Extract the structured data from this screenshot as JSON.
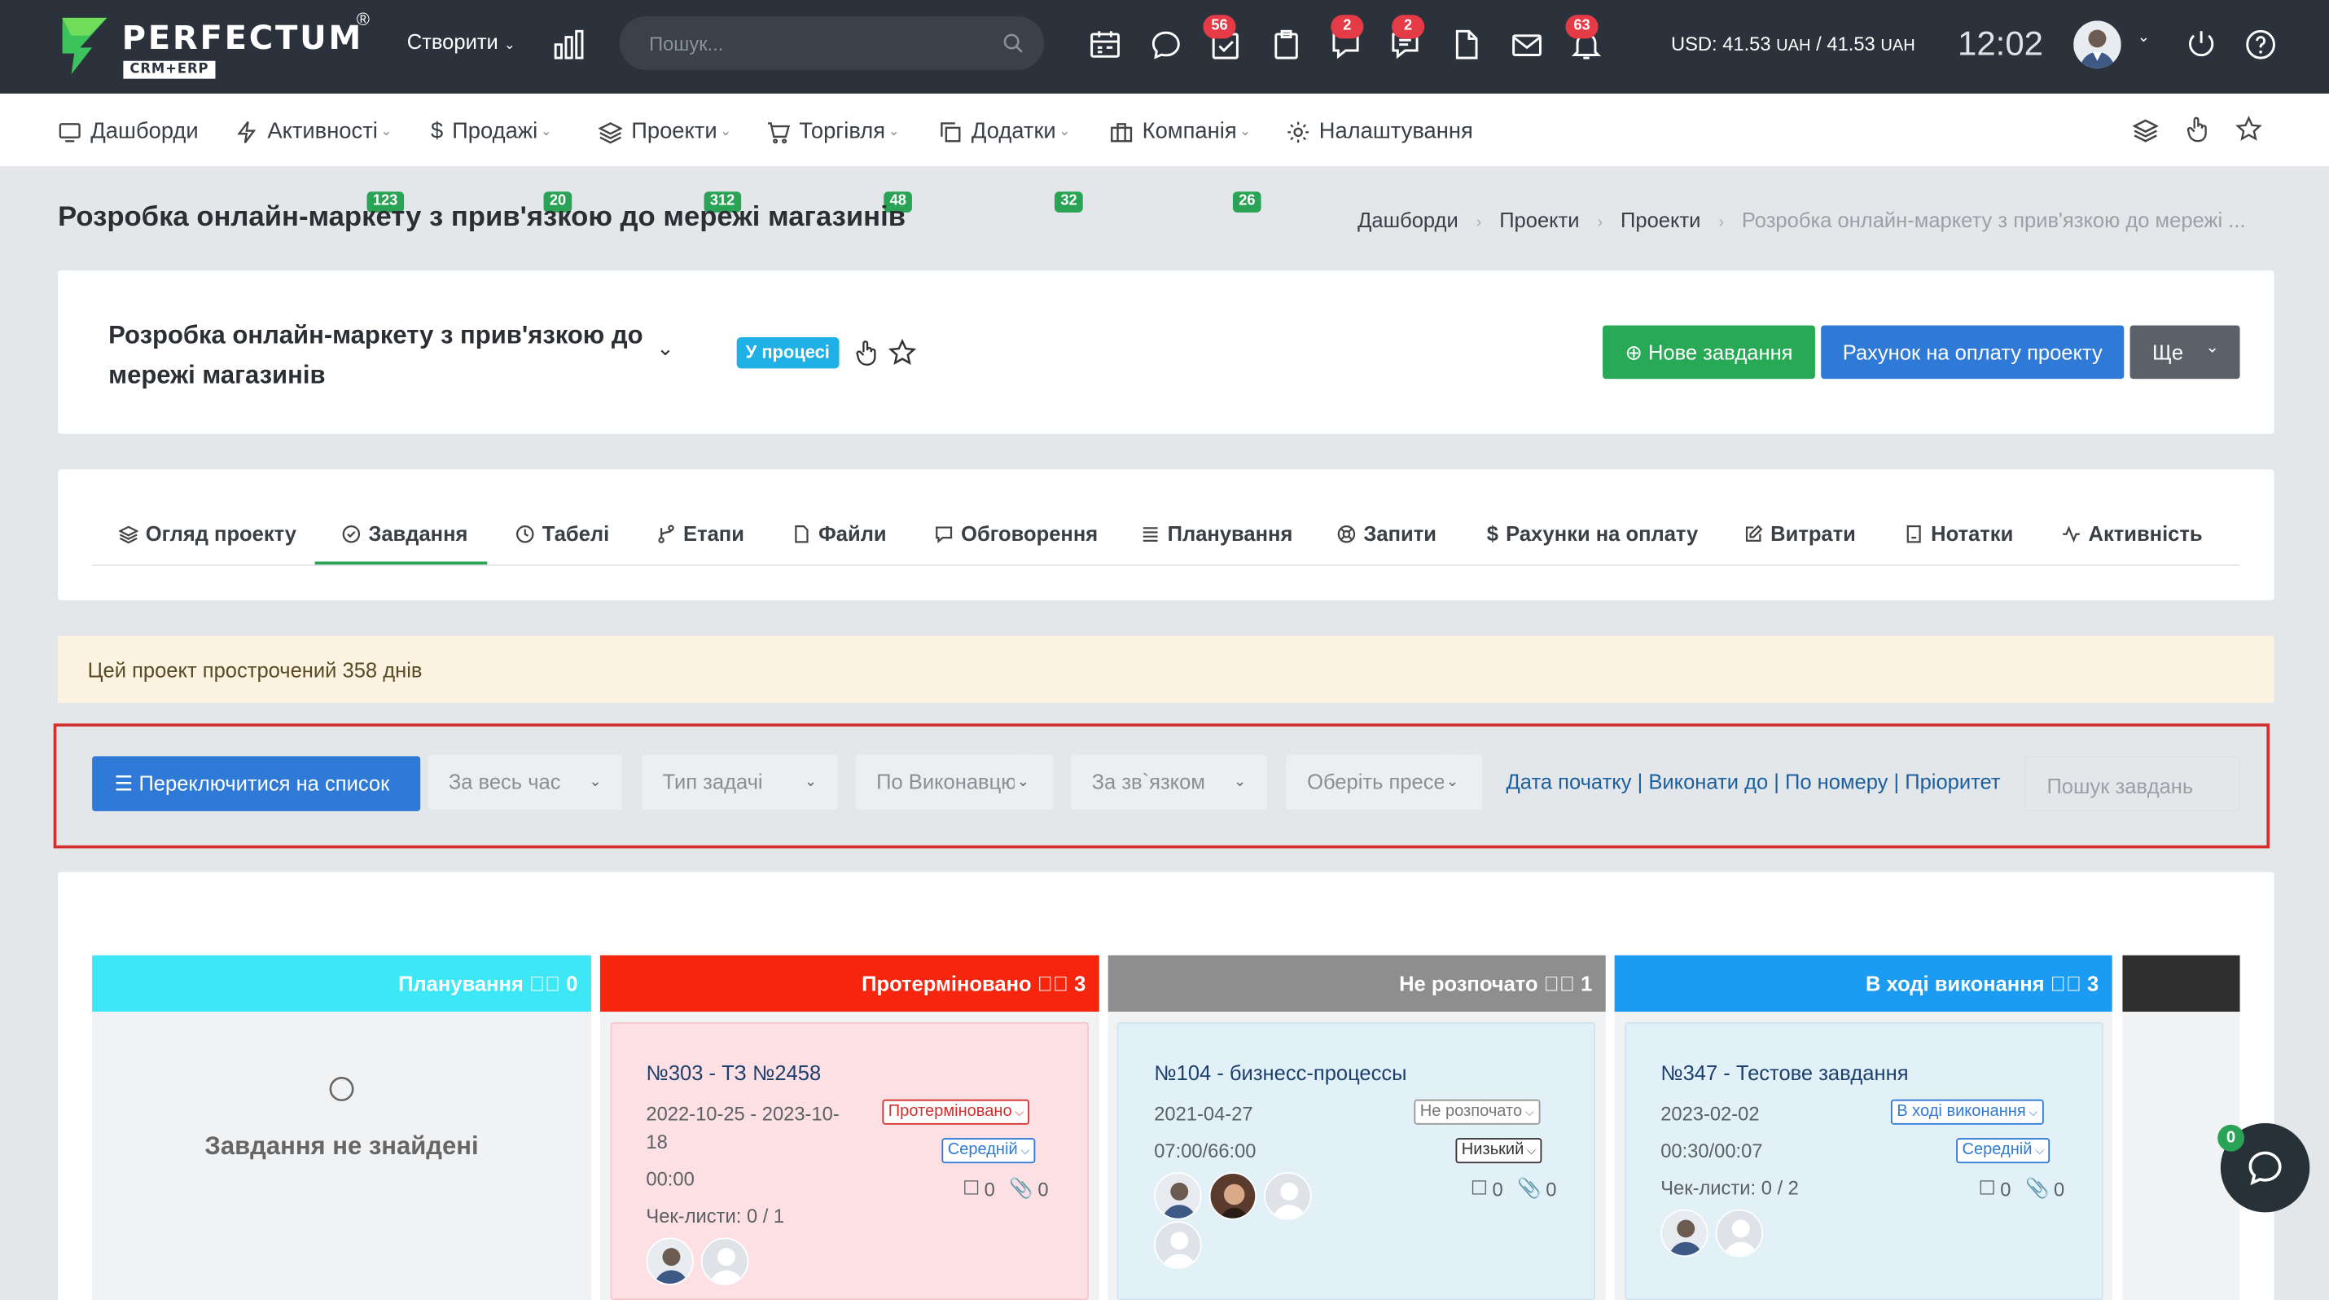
{
  "topbar": {
    "logo_text": "PERFECTUM",
    "logo_sub": "CRM+ERP",
    "logo_reg": "®",
    "create_label": "Створити",
    "search_placeholder": "Пошук...",
    "badges": {
      "tasks": "56",
      "feedback": "2",
      "chat": "2",
      "notifications": "63"
    },
    "rate": "USD: 41.53",
    "rate_unit": "UAH",
    "rate_sep": "/",
    "rate2": "41.53",
    "clock": "12:02"
  },
  "nav": [
    {
      "label": "Дашборди",
      "badge": ""
    },
    {
      "label": "Активності",
      "badge": "123"
    },
    {
      "label": "Продажі",
      "badge": "20"
    },
    {
      "label": "Проекти",
      "badge": "312"
    },
    {
      "label": "Торгівля",
      "badge": "48"
    },
    {
      "label": "Додатки",
      "badge": "32"
    },
    {
      "label": "Компанія",
      "badge": "26"
    },
    {
      "label": "Налаштування",
      "badge": ""
    }
  ],
  "page": {
    "title": "Розробка онлайн-маркету з прив'язкою до мережі магазинів",
    "breadcrumbs": [
      "Дашборди",
      "Проекти",
      "Проекти",
      "Розробка онлайн-маркету з прив'язкою до мережі ..."
    ]
  },
  "project": {
    "title": "Розробка онлайн-маркету з прив'язкою до мережі магазинів",
    "status": "У процесі",
    "btn_new_task": "Нове завдання",
    "btn_invoice": "Рахунок на оплату проекту",
    "btn_more": "Ще"
  },
  "tabs": [
    "Огляд проекту",
    "Завдання",
    "Табелі",
    "Етапи",
    "Файли",
    "Обговорення",
    "Планування",
    "Запити",
    "Рахунки на оплату",
    "Витрати",
    "Нотатки",
    "Активність"
  ],
  "alert": "Цей проект прострочений 358 днів",
  "filters": {
    "switch_list": "Переключитися на список",
    "period": "За весь час",
    "task_type": "Тип задачі",
    "assignee": "По Виконавцю",
    "relation": "За зв`язком",
    "preset": "Оберіть пресет",
    "sort_start": "Дата початку",
    "sort_due": "Виконати до",
    "sort_number": "По номеру",
    "sort_priority": "Пріоритет",
    "sort_sep": "|",
    "search_placeholder": "Пошук завдань"
  },
  "columns": [
    {
      "name": "Планування",
      "count": "0",
      "color": "#3ee7f5"
    },
    {
      "name": "Протерміновано",
      "count": "3",
      "color": "#f5250e"
    },
    {
      "name": "Не розпочато",
      "count": "1",
      "color": "#8e8e8e"
    },
    {
      "name": "В ході виконання",
      "count": "3",
      "color": "#1b9cf2"
    },
    {
      "name": "",
      "count": "",
      "color": "#2e2e2e"
    }
  ],
  "empty_column": "Завдання не знайдені",
  "cards": [
    {
      "title": "№303 - ТЗ №2458",
      "dates": "2022-10-25 - 2023-10-18",
      "time": "00:00",
      "status": "Протерміновано",
      "priority": "Середній",
      "checklist": "Чек-листи:",
      "checklist_value": "0 / 1",
      "comments": "0",
      "files": "0"
    },
    {
      "title": "№104 - бизнесс-процессы",
      "dates": "2021-04-27",
      "time": "07:00/66:00",
      "status": "Не розпочато",
      "priority": "Низький",
      "comments": "0",
      "files": "0"
    },
    {
      "title": "№347 - Тестове завдання",
      "dates": "2023-02-02",
      "time": "00:30/00:07",
      "status": "В ході виконання",
      "priority": "Середній",
      "checklist": "Чек-листи:",
      "checklist_value": "0 / 2",
      "comments": "0",
      "files": "0"
    }
  ],
  "chat_badge": "0"
}
